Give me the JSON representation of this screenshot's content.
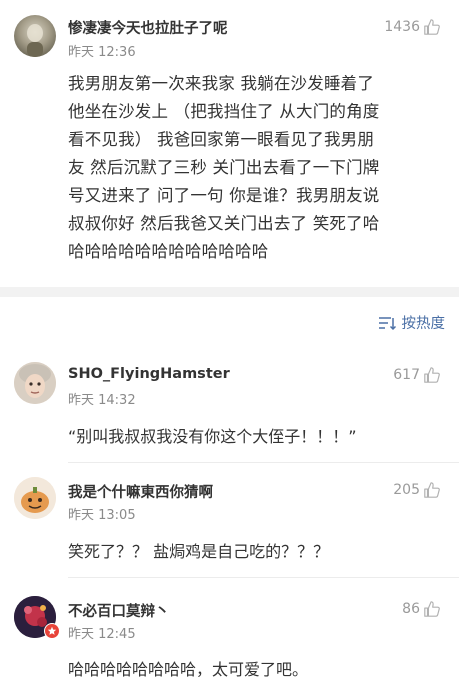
{
  "post": {
    "username": "惨凄凄今天也拉肚子了呢",
    "time": "昨天 12:36",
    "likes": "1436",
    "lines": [
      "我男朋友第一次来我家 我躺在沙发睡着了",
      "他坐在沙发上 （把我挡住了 从大门的角度",
      "看不见我） 我爸回家第一眼看见了我男朋",
      "友 然后沉默了三秒 关门出去看了一下门牌",
      "号又进来了 问了一句 你是谁？我男朋友说",
      "叔叔你好 然后我爸又关门出去了 笑死了哈",
      "哈哈哈哈哈哈哈哈哈哈哈哈"
    ]
  },
  "sort": {
    "label": "按热度",
    "icon": "sort-icon"
  },
  "comments": [
    {
      "username": "SHO_FlyingHamster",
      "time": "昨天 14:32",
      "likes": "617",
      "text": "“别叫我叔叔我没有你这个大侄子！！！”"
    },
    {
      "username": "我是个什嘛東西你猜啊",
      "time": "昨天 13:05",
      "likes": "205",
      "text": "笑死了？？ 盐焗鸡是自己吃的？？？"
    },
    {
      "username": "不必百口莫辩丶",
      "time": "昨天 12:45",
      "likes": "86",
      "text": "哈哈哈哈哈哈哈哈，太可爱了吧。"
    }
  ],
  "colors": {
    "accent": "#4a6fa5",
    "badge": "#e8443a"
  }
}
